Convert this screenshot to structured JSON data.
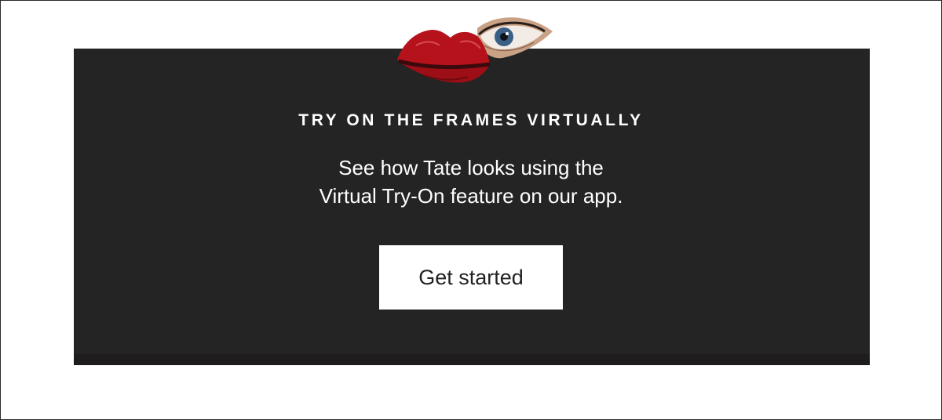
{
  "promo": {
    "heading": "TRY ON THE FRAMES VIRTUALLY",
    "body_line_1": "See how Tate looks using the",
    "body_line_2": "Virtual Try-On feature on our app.",
    "cta_label": "Get started",
    "collage_icons": [
      "lips-icon",
      "eye-icon"
    ]
  },
  "colors": {
    "page_background": "#ffffff",
    "panel_background": "#242424",
    "text": "#ffffff",
    "button_background": "#ffffff",
    "button_text": "#222222",
    "lips": "#b5121b"
  }
}
